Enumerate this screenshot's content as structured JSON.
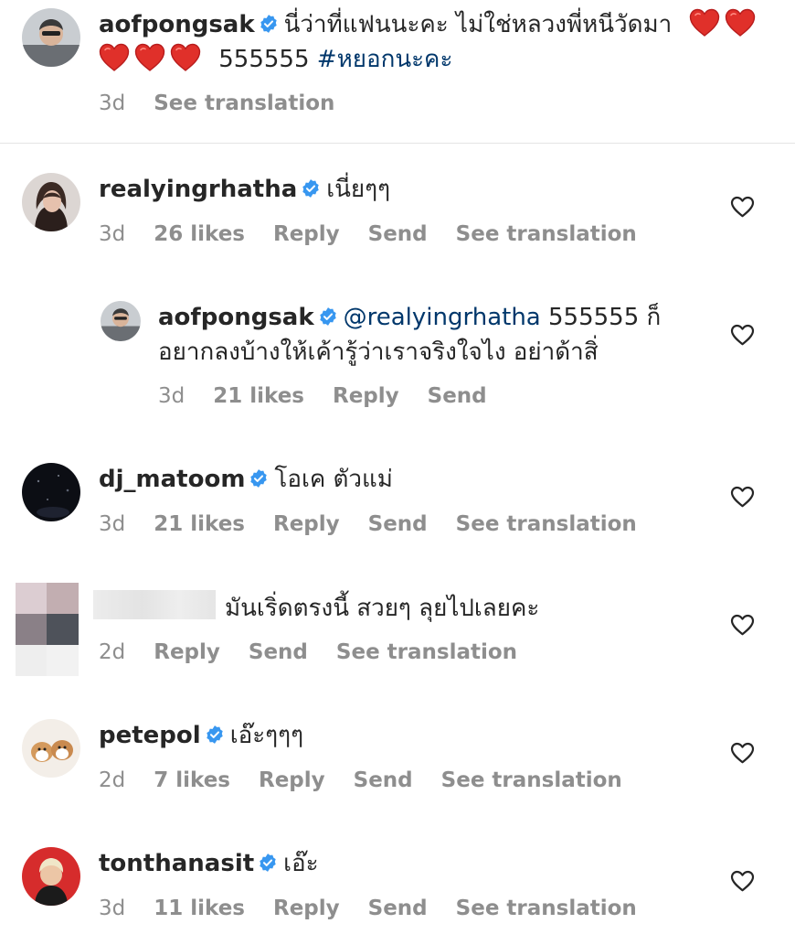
{
  "post_caption": {
    "username": "aofpongsak",
    "text": "นี่ว่าที่แฟนนะคะ ไม่ใช่หลวงพี่หนีวัดมา",
    "suffix": "555555",
    "hashtag": "#หยอกนะคะ",
    "time": "3d",
    "see_translation": "See translation"
  },
  "comments": [
    {
      "username": "realyingrhatha",
      "text": "เนี่ยๆๆ",
      "time": "3d",
      "likes": "26 likes",
      "reply": "Reply",
      "send": "Send",
      "see_translation": "See translation",
      "reply_item": {
        "username": "aofpongsak",
        "mention": "@realyingrhatha",
        "text_line1": "555555 ก็",
        "text_line2": "อยากลงบ้างให้เค้ารู้ว่าเราจริงใจไง อย่าด้าสิ่",
        "time": "3d",
        "likes": "21 likes",
        "reply": "Reply",
        "send": "Send"
      }
    },
    {
      "username": "dj_matoom",
      "text": "โอเค ตัวแม่",
      "time": "3d",
      "likes": "21 likes",
      "reply": "Reply",
      "send": "Send",
      "see_translation": "See translation"
    },
    {
      "text": "มันเริ่ดตรงนี้ สวยๆ ลุยไปเลยคะ",
      "time": "2d",
      "reply": "Reply",
      "send": "Send",
      "see_translation": "See translation"
    },
    {
      "username": "petepol",
      "text": "เอ๊ะๆๆๆ",
      "time": "2d",
      "likes": "7 likes",
      "reply": "Reply",
      "send": "Send",
      "see_translation": "See translation"
    },
    {
      "username": "tonthanasit",
      "text": "เอ๊ะ",
      "time": "3d",
      "likes": "11 likes",
      "reply": "Reply",
      "send": "Send",
      "see_translation": "See translation"
    }
  ],
  "icons": {
    "verified": "verified-badge-icon",
    "like": "heart-outline-icon",
    "emoji": "red-heart-emoji-icon"
  },
  "colors": {
    "text": "#262626",
    "meta": "#8e8e8e",
    "link": "#00376b",
    "verified": "#3897f0",
    "emoji_heart": "#e0302a"
  }
}
